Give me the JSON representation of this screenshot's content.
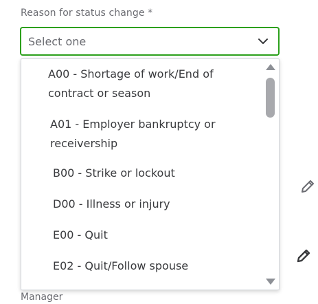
{
  "field": {
    "label": "Reason for status change *",
    "selected_value": "Select one"
  },
  "dropdown": {
    "options": [
      {
        "label": "A00 - Shortage of work/End of contract or season"
      },
      {
        "label": "A01 - Employer bankruptcy or receivership"
      },
      {
        "label": "B00 - Strike or lockout"
      },
      {
        "label": "D00 - Illness or injury"
      },
      {
        "label": "E00 - Quit"
      },
      {
        "label": "E02 - Quit/Follow spouse"
      }
    ]
  },
  "below": {
    "label": "Manager"
  },
  "icons": {
    "chevron": "chevron-down-icon",
    "pencil": "pencil-icon",
    "scroll_up": "scroll-up-arrow",
    "scroll_down": "scroll-down-arrow"
  },
  "colors": {
    "accent_border": "#2ca01c",
    "text": "#393a3d",
    "muted_text": "#6b6c72"
  }
}
